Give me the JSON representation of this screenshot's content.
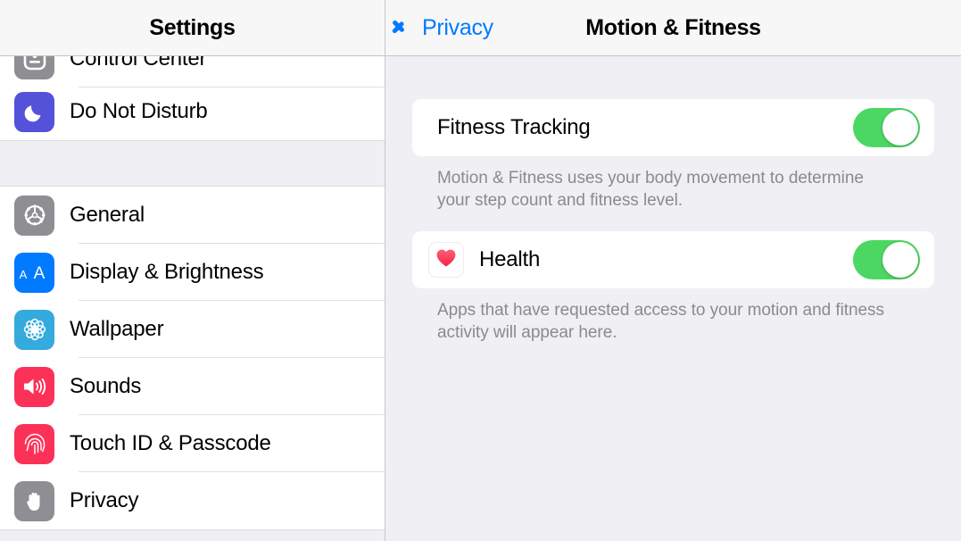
{
  "sidebar": {
    "title": "Settings",
    "items": [
      {
        "label": "Control Center",
        "icon": "control-center-icon",
        "icon_color": "#8e8e93",
        "partial": true
      },
      {
        "label": "Do Not Disturb",
        "icon": "moon-icon",
        "icon_color": "#5352d9"
      },
      {
        "label": "General",
        "icon": "gear-icon",
        "icon_color": "#8e8e93"
      },
      {
        "label": "Display & Brightness",
        "icon": "text-size-aa-icon",
        "icon_color": "#007aff"
      },
      {
        "label": "Wallpaper",
        "icon": "flower-icon",
        "icon_color": "#35aadc"
      },
      {
        "label": "Sounds",
        "icon": "speaker-icon",
        "icon_color": "#fc3158"
      },
      {
        "label": "Touch ID & Passcode",
        "icon": "fingerprint-icon",
        "icon_color": "#fc3158"
      },
      {
        "label": "Privacy",
        "icon": "hand-icon",
        "icon_color": "#8e8e93"
      }
    ]
  },
  "detail": {
    "back_label": "Privacy",
    "back_icon": "chevron-left-icon",
    "title": "Motion & Fitness",
    "sections": [
      {
        "rows": [
          {
            "label": "Fitness Tracking",
            "toggle": "on",
            "icon": null
          }
        ],
        "footnote": "Motion & Fitness uses your body movement to determine your step count and fitness level."
      },
      {
        "rows": [
          {
            "label": "Health",
            "toggle": "on",
            "icon": "health-heart-icon"
          }
        ],
        "footnote": "Apps that have requested access to your motion and fitness activity will appear here."
      }
    ]
  },
  "colors": {
    "accent_blue": "#007aff",
    "toggle_on_green": "#4cd763",
    "page_background": "#efeff4",
    "card_background": "#ffffff",
    "footnote_text": "#8a8a8f",
    "health_heart": "#fc3158"
  }
}
